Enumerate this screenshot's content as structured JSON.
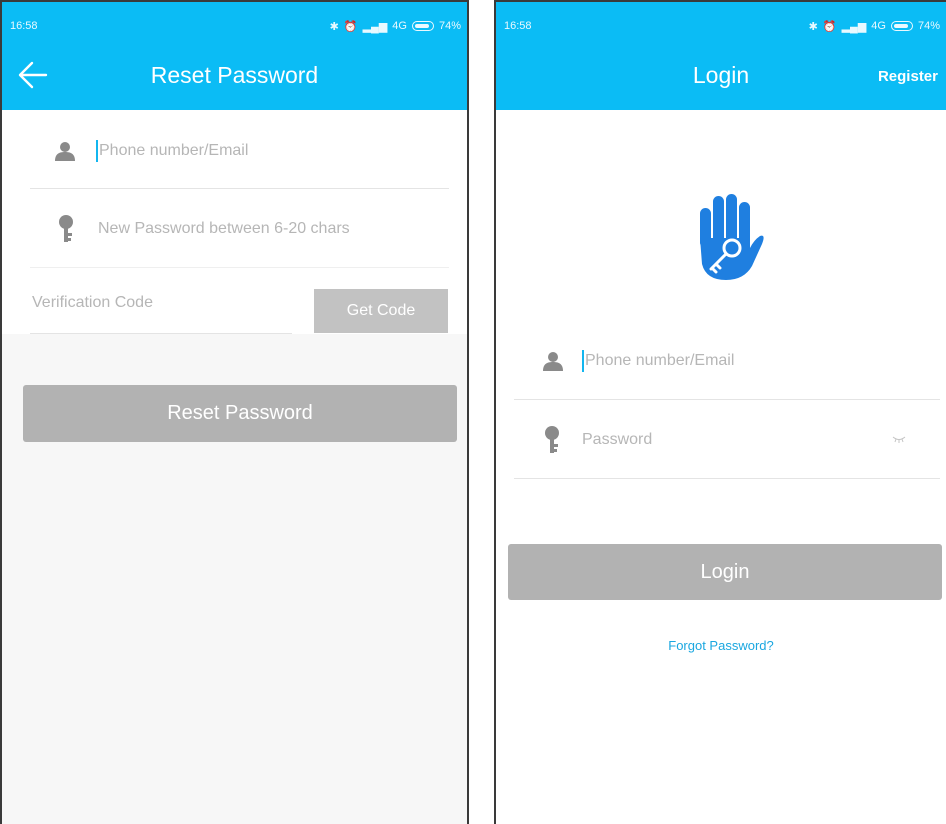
{
  "reset_screen": {
    "status": {
      "time": "16:58",
      "network": "4G",
      "battery": "74%"
    },
    "title": "Reset Password",
    "phone_placeholder": "Phone number/Email",
    "password_placeholder": "New Password between 6-20 chars",
    "code_placeholder": "Verification Code",
    "get_code_label": "Get Code",
    "submit_label": "Reset Password"
  },
  "login_screen": {
    "status": {
      "time": "16:58",
      "network": "4G",
      "battery": "74%"
    },
    "title": "Login",
    "register_label": "Register",
    "phone_placeholder": "Phone number/Email",
    "password_placeholder": "Password",
    "submit_label": "Login",
    "forgot_label": "Forgot Password?"
  },
  "colors": {
    "brand_blue": "#0bbcf5",
    "logo_blue": "#1f7fe0",
    "button_gray": "#b2b2b2",
    "link_blue": "#1aa7e0"
  },
  "icons": [
    "back-arrow-icon",
    "person-icon",
    "key-icon",
    "bluetooth-icon",
    "alarm-icon",
    "signal-icon",
    "battery-icon",
    "password-eye-icon",
    "hand-key-logo"
  ]
}
